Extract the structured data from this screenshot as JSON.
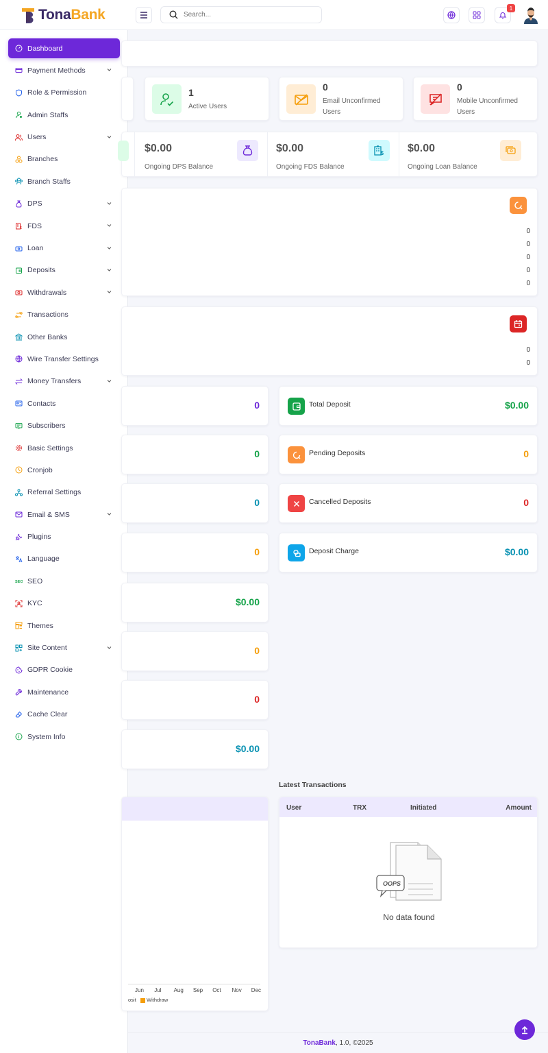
{
  "app": {
    "name_part1": "Tona",
    "name_part2": "Bank"
  },
  "search": {
    "placeholder": "Search..."
  },
  "topbar": {
    "notification_count": "1"
  },
  "sidebar": {
    "items": [
      {
        "label": "Dashboard",
        "icon": "dashboard-icon",
        "active": true
      },
      {
        "label": "Payment Methods",
        "icon": "card-icon",
        "dropdown": true
      },
      {
        "label": "Role & Permission",
        "icon": "shield-icon"
      },
      {
        "label": "Admin Staffs",
        "icon": "user-icon"
      },
      {
        "label": "Users",
        "icon": "users-icon",
        "dropdown": true
      },
      {
        "label": "Branches",
        "icon": "branch-icon"
      },
      {
        "label": "Branch Staffs",
        "icon": "staff-icon"
      },
      {
        "label": "DPS",
        "icon": "bag-icon",
        "dropdown": true
      },
      {
        "label": "FDS",
        "icon": "building-icon",
        "dropdown": true
      },
      {
        "label": "Loan",
        "icon": "loan-icon",
        "dropdown": true
      },
      {
        "label": "Deposits",
        "icon": "wallet-icon",
        "dropdown": true
      },
      {
        "label": "Withdrawals",
        "icon": "cash-icon",
        "dropdown": true
      },
      {
        "label": "Transactions",
        "icon": "exchange-icon"
      },
      {
        "label": "Other Banks",
        "icon": "bank-icon"
      },
      {
        "label": "Wire Transfer Settings",
        "icon": "globe-icon"
      },
      {
        "label": "Money Transfers",
        "icon": "transfer-icon",
        "dropdown": true
      },
      {
        "label": "Contacts",
        "icon": "contact-icon"
      },
      {
        "label": "Subscribers",
        "icon": "subscriber-icon"
      },
      {
        "label": "Basic Settings",
        "icon": "gear-icon"
      },
      {
        "label": "Cronjob",
        "icon": "clock-icon"
      },
      {
        "label": "Referral Settings",
        "icon": "referral-icon"
      },
      {
        "label": "Email & SMS",
        "icon": "mail-icon",
        "dropdown": true
      },
      {
        "label": "Plugins",
        "icon": "plug-icon"
      },
      {
        "label": "Language",
        "icon": "language-icon"
      },
      {
        "label": "SEO",
        "icon": "seo-icon"
      },
      {
        "label": "KYC",
        "icon": "scan-icon"
      },
      {
        "label": "Themes",
        "icon": "theme-icon"
      },
      {
        "label": "Site Content",
        "icon": "grid-icon",
        "dropdown": true
      },
      {
        "label": "GDPR Cookie",
        "icon": "cookie-icon"
      },
      {
        "label": "Maintenance",
        "icon": "wrench-icon"
      },
      {
        "label": "Cache Clear",
        "icon": "eraser-icon"
      },
      {
        "label": "System Info",
        "icon": "info-icon"
      }
    ]
  },
  "stats": [
    {
      "value": "1",
      "label": "Active Users"
    },
    {
      "value": "0",
      "label": "Email Unconfirmed Users"
    },
    {
      "value": "0",
      "label": "Mobile Unconfirmed Users"
    }
  ],
  "balances": [
    {
      "value": "$0.00",
      "label": "Ongoing DPS Balance"
    },
    {
      "value": "$0.00",
      "label": "Ongoing FDS Balance"
    },
    {
      "value": "$0.00",
      "label": "Ongoing Loan Balance"
    }
  ],
  "pending_list": {
    "values": [
      "0",
      "0",
      "0",
      "0",
      "0"
    ]
  },
  "schedule_list": {
    "values": [
      "0",
      "0"
    ]
  },
  "left_minis": [
    {
      "value": "0",
      "color": "#6d28d9"
    },
    {
      "value": "0",
      "color": "#16a34a"
    },
    {
      "value": "0",
      "color": "#0891b2"
    },
    {
      "value": "0",
      "color": "#f59e0b"
    },
    {
      "value": "$0.00",
      "color": "#16a34a"
    },
    {
      "value": "0",
      "color": "#f59e0b"
    },
    {
      "value": "0",
      "color": "#dc2626"
    },
    {
      "value": "$0.00",
      "color": "#0891b2"
    }
  ],
  "deposits": [
    {
      "label": "Total Deposit",
      "value": "$0.00",
      "color": "#16a34a"
    },
    {
      "label": "Pending Deposits",
      "value": "0",
      "color": "#f59e0b"
    },
    {
      "label": "Cancelled Deposits",
      "value": "0",
      "color": "#dc2626"
    },
    {
      "label": "Deposit Charge",
      "value": "$0.00",
      "color": "#0891b2"
    }
  ],
  "chart": {
    "months": [
      "Jun",
      "Jul",
      "Aug",
      "Sep",
      "Oct",
      "Nov",
      "Dec"
    ],
    "legend_deposit": "osit",
    "legend_withdraw": "Withdraw"
  },
  "transactions": {
    "title": "Latest Transactions",
    "headers": [
      "User",
      "TRX",
      "Initiated",
      "Amount"
    ],
    "oops": "OOPS",
    "empty": "No data found"
  },
  "footer": {
    "brand": "TonaBank",
    "rest": ", 1.0, ©2025"
  },
  "colors": {
    "accent": "#6d28d9",
    "logo_gold": "#f4a623"
  }
}
